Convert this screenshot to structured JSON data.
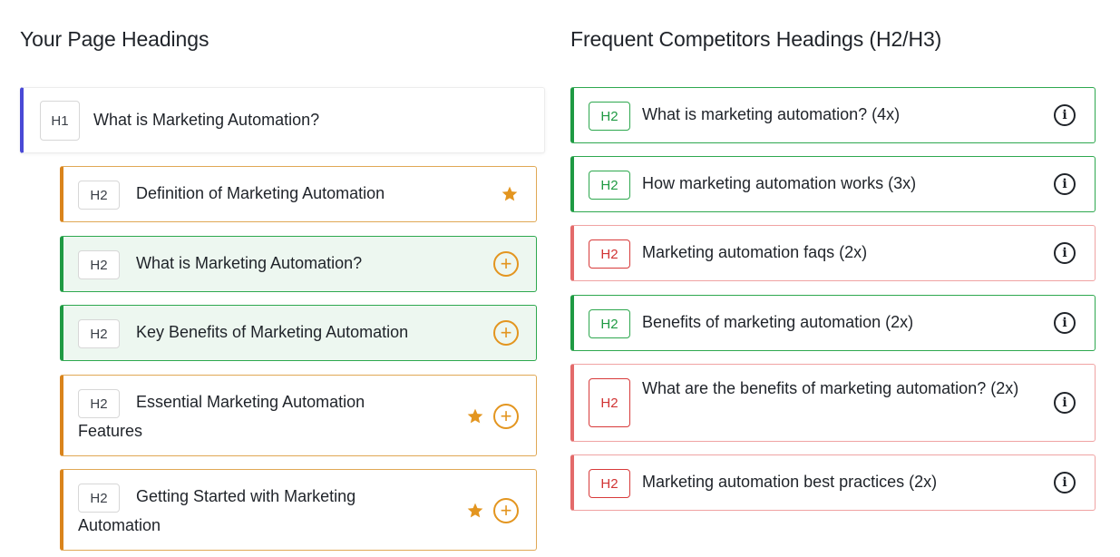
{
  "left": {
    "title": "Your Page Headings",
    "h1": {
      "tag": "H1",
      "text": "What is Marketing Automation?"
    },
    "items": [
      {
        "tag": "H2",
        "text": "Definition of Marketing Automation"
      },
      {
        "tag": "H2",
        "text": "What is Marketing Automation?"
      },
      {
        "tag": "H2",
        "text": "Key Benefits of Marketing Automation"
      },
      {
        "tag": "H2",
        "text": "Essential Marketing Automation Features"
      },
      {
        "tag": "H2",
        "text": "Getting Started with Marketing Automation"
      }
    ]
  },
  "right": {
    "title": "Frequent Competitors Headings (H2/H3)",
    "items": [
      {
        "tag": "H2",
        "text": "What is marketing automation? (4x)",
        "status": "green"
      },
      {
        "tag": "H2",
        "text": "How marketing automation works (3x)",
        "status": "green"
      },
      {
        "tag": "H2",
        "text": "Marketing automation faqs (2x)",
        "status": "red"
      },
      {
        "tag": "H2",
        "text": "Benefits of marketing automation (2x)",
        "status": "green"
      },
      {
        "tag": "H2",
        "text": "What are the benefits of marketing automation? (2x)",
        "status": "red"
      },
      {
        "tag": "H2",
        "text": "Marketing automation best practices (2x)",
        "status": "red"
      }
    ]
  },
  "icons": {
    "star": "star-icon",
    "add": "add-circle-icon",
    "info": "info-icon"
  },
  "colors": {
    "h1_accent": "#4a4ad6",
    "orange": "#d9841c",
    "green": "#1f9a43",
    "red": "#e36a6a"
  }
}
